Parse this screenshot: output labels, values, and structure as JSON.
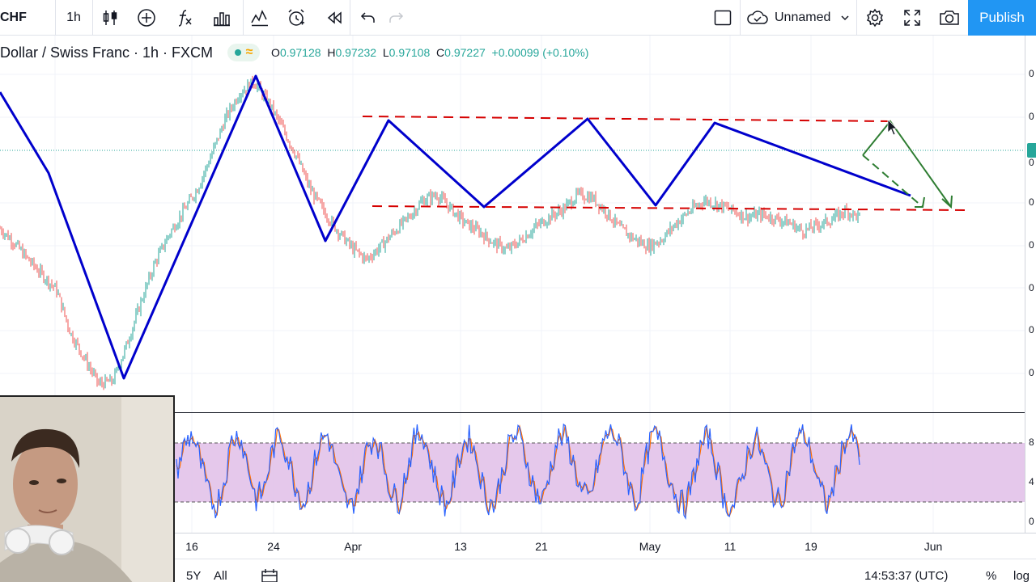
{
  "toolbar": {
    "symbol": "CHF",
    "interval": "1h",
    "layout_name": "Unnamed",
    "publish_label": "Publish"
  },
  "legend": {
    "title": "Dollar / Swiss Franc · 1h · FXCM",
    "open_label": "O",
    "open": "0.97128",
    "high_label": "H",
    "high": "0.97232",
    "low_label": "L",
    "low": "0.97108",
    "close_label": "C",
    "close": "0.97227",
    "change": "+0.00099 (+0.10%)"
  },
  "colors": {
    "accent": "#2196f3",
    "up": "#26a69a",
    "down": "#ef5350",
    "pattern": "#0000cc",
    "channel": "#d50000",
    "projection": "#2e7d32",
    "osc_band": "#e1bee7",
    "stoch_k": "#2962ff",
    "stoch_d": "#ff6d00"
  },
  "price_scale_ticks": [
    "0",
    "0",
    "0",
    "0",
    "0",
    "0",
    "0",
    "0"
  ],
  "osc_scale_ticks": [
    "8",
    "4",
    "0"
  ],
  "time_axis": [
    "16",
    "24",
    "Apr",
    "13",
    "21",
    "May",
    "11",
    "19",
    "Jun"
  ],
  "bottom_bar": {
    "range_5y": "5Y",
    "range_all": "All",
    "clock": "14:53:37 (UTC)",
    "percent": "%",
    "log": "log"
  },
  "chart_data": [
    {
      "type": "line",
      "title": "",
      "series": [
        {
          "values": [
            0.963,
            0.9605,
            0.9575,
            0.9548,
            0.9522,
            0.9445,
            0.94,
            0.9355,
            0.936,
            0.9425,
            0.95,
            0.957,
            0.962,
            0.966,
            0.97,
            0.976,
            0.9825,
            0.987,
            0.989,
            0.9855,
            0.981,
            0.976,
            0.97,
            0.966,
            0.9625,
            0.9595,
            0.9575,
            0.9598,
            0.9625,
            0.965,
            0.968,
            0.969,
            0.9665,
            0.964,
            0.9625,
            0.9605,
            0.9592,
            0.961,
            0.9633,
            0.965,
            0.9665,
            0.969,
            0.9685,
            0.966,
            0.963,
            0.9612,
            0.9598,
            0.9612,
            0.964,
            0.9662,
            0.968,
            0.9672,
            0.9662,
            0.965,
            0.9655,
            0.9648,
            0.964,
            0.9625,
            0.9636,
            0.9645,
            0.9662,
            0.965
          ]
        }
      ]
    },
    {
      "type": "line",
      "title": "",
      "ylim": [
        0,
        100
      ],
      "series": [
        {
          "values": [
            50,
            78,
            90,
            60,
            25,
            12,
            40,
            85,
            88,
            55,
            20,
            30,
            70,
            92,
            65,
            35,
            15,
            45,
            80,
            90,
            58,
            22,
            10,
            38,
            75,
            88,
            62,
            28,
            18,
            52,
            85,
            92,
            60,
            30,
            12,
            42,
            78,
            86,
            55,
            20,
            14,
            48,
            82,
            90,
            64,
            32,
            16,
            50,
            84,
            88,
            58,
            26,
            20,
            55,
            88,
            92,
            70,
            34,
            14,
            60,
            90,
            80,
            45,
            22,
            12,
            40,
            76,
            88,
            54,
            18,
            10,
            36,
            72,
            86,
            60,
            28,
            15,
            50,
            84,
            90,
            66,
            30,
            12,
            44,
            80,
            92,
            62
          ]
        }
      ]
    }
  ]
}
